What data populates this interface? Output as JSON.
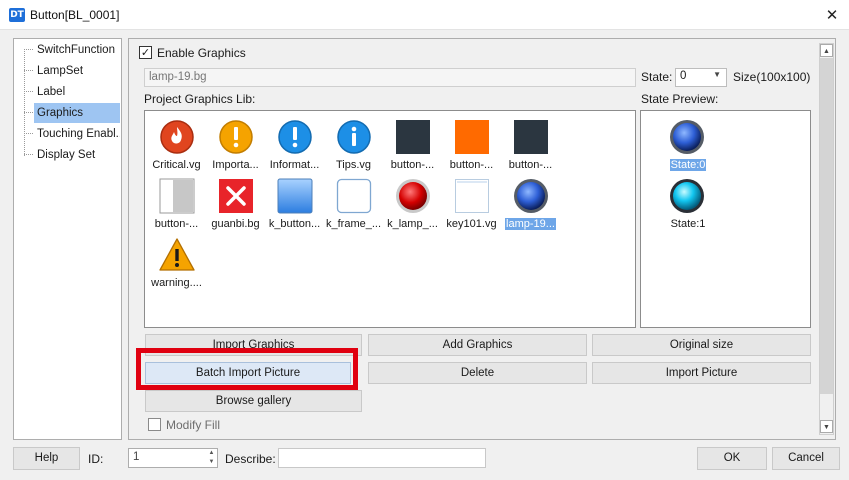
{
  "window": {
    "app_icon": "DT",
    "title": "Button[BL_0001]",
    "close": "✕"
  },
  "nav": {
    "items": [
      {
        "label": "SwitchFunction"
      },
      {
        "label": "LampSet"
      },
      {
        "label": "Label"
      },
      {
        "label": "Graphics",
        "selected": true
      },
      {
        "label": "Touching Enabl..."
      },
      {
        "label": "Display Set"
      }
    ]
  },
  "graphics": {
    "enable_label": "Enable Graphics",
    "enable_checked": "✓",
    "path_value": "lamp-19.bg",
    "state_label": "State:",
    "state_value": "0",
    "size_label": "Size(100x100)",
    "lib_label": "Project Graphics Lib:",
    "preview_label": "State Preview:",
    "library": [
      {
        "name": "Critical.vg",
        "icon": "critical-icon"
      },
      {
        "name": "Importa...",
        "icon": "important-icon"
      },
      {
        "name": "Informat...",
        "icon": "information-icon"
      },
      {
        "name": "Tips.vg",
        "icon": "tips-icon"
      },
      {
        "name": "button-...",
        "icon": "dark-square-icon"
      },
      {
        "name": "button-...",
        "icon": "orange-square-icon"
      },
      {
        "name": "button-...",
        "icon": "dark-square-icon"
      },
      {
        "name": "button-...",
        "icon": "half-toggle-icon"
      },
      {
        "name": "guanbi.bg",
        "icon": "close-x-icon"
      },
      {
        "name": "k_button...",
        "icon": "blue-button-icon"
      },
      {
        "name": "k_frame_...",
        "icon": "frame-icon"
      },
      {
        "name": "k_lamp_...",
        "icon": "red-lamp-icon"
      },
      {
        "name": "key101.vg",
        "icon": "key-icon"
      },
      {
        "name": "lamp-19...",
        "icon": "blue-lamp-icon",
        "selected": true
      },
      {
        "name": "warning....",
        "icon": "warning-icon"
      }
    ],
    "states": [
      {
        "name": "State:0",
        "icon": "blue-lamp-off-icon",
        "selected": true
      },
      {
        "name": "State:1",
        "icon": "blue-lamp-on-icon"
      }
    ],
    "buttons": {
      "import_graphics": "Import Graphics",
      "add_graphics": "Add Graphics",
      "original_size": "Original size",
      "batch_import": "Batch Import Picture",
      "delete": "Delete",
      "import_picture": "Import Picture",
      "browse_gallery": "Browse gallery"
    },
    "modify_fill_label": "Modify Fill"
  },
  "footer": {
    "help": "Help",
    "id_label": "ID:",
    "id_value": "1",
    "describe_label": "Describe:",
    "ok": "OK",
    "cancel": "Cancel"
  },
  "colors": {
    "highlight_box": "#e00010",
    "selection": "#9ec5f2"
  }
}
